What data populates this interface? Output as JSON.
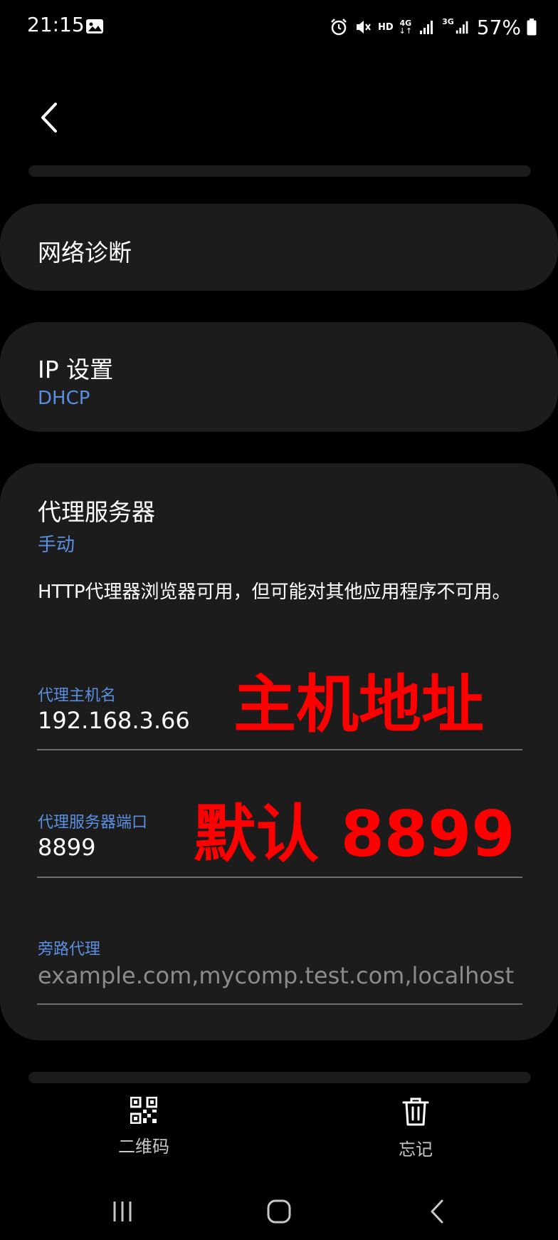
{
  "status": {
    "time": "21:15",
    "hd": "HD",
    "net4g": "4G",
    "net3g": "3G",
    "battery": "57%"
  },
  "rows": {
    "diagnostics": {
      "title": "网络诊断"
    },
    "ip": {
      "title": "IP 设置",
      "value": "DHCP"
    },
    "proxy": {
      "title": "代理服务器",
      "mode": "手动",
      "description": "HTTP代理器浏览器可用，但可能对其他应用程序不可用。"
    }
  },
  "fields": {
    "host": {
      "label": "代理主机名",
      "value": "192.168.3.66"
    },
    "port": {
      "label": "代理服务器端口",
      "value": "8899"
    },
    "bypass": {
      "label": "旁路代理",
      "placeholder": "example.com,mycomp.test.com,localhost"
    }
  },
  "annotations": {
    "host": "主机地址",
    "port": "默认 8899"
  },
  "bottom": {
    "qr_label": "二维码",
    "forget_label": "忘记"
  },
  "colors": {
    "accent": "#5a8fe0",
    "annotation": "#ff0000",
    "card": "#1c1c1c"
  }
}
